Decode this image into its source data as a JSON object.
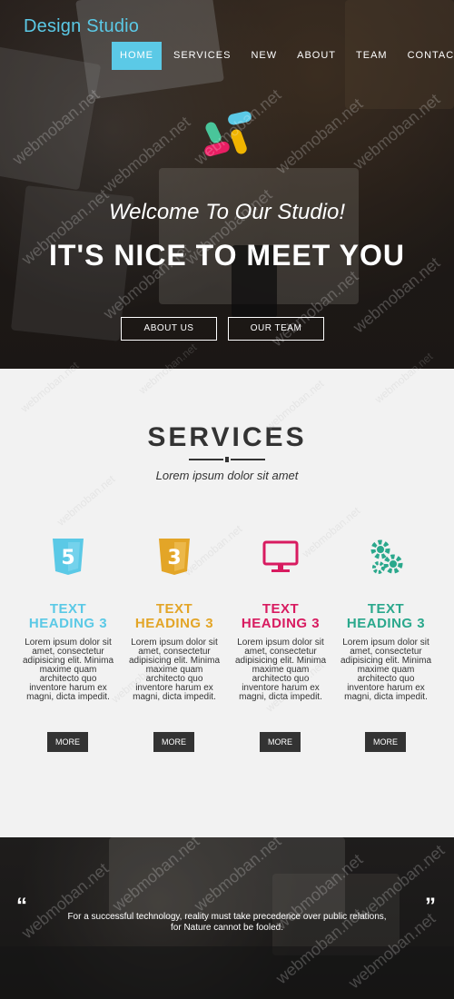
{
  "brand": {
    "name": "Design Studio"
  },
  "nav": {
    "items": [
      "HOME",
      "SERVICES",
      "NEW",
      "ABOUT",
      "TEAM",
      "CONTACT"
    ],
    "active_index": 0
  },
  "hero": {
    "welcome": "Welcome To Our Studio!",
    "headline": "IT'S NICE TO MEET YOU",
    "buttons": [
      {
        "label": "ABOUT US"
      },
      {
        "label": "OUR TEAM"
      }
    ]
  },
  "services": {
    "title": "SERVICES",
    "subtitle": "Lorem ipsum dolor sit amet",
    "items": [
      {
        "icon": "html5-icon",
        "heading_line1": "TEXT",
        "heading_line2": "HEADING 3",
        "color": "#5bc9e6",
        "text": "Lorem ipsum dolor sit amet, consectetur adipisicing elit. Minima maxime quam architecto quo inventore harum ex magni, dicta impedit.",
        "button": "MORE"
      },
      {
        "icon": "css3-icon",
        "heading_line1": "TEXT",
        "heading_line2": "HEADING 3",
        "color": "#e3a527",
        "text": "Lorem ipsum dolor sit amet, consectetur adipisicing elit. Minima maxime quam architecto quo inventore harum ex magni, dicta impedit.",
        "button": "MORE"
      },
      {
        "icon": "monitor-icon",
        "heading_line1": "TEXT",
        "heading_line2": "HEADING 3",
        "color": "#d81b60",
        "text": "Lorem ipsum dolor sit amet, consectetur adipisicing elit. Minima maxime quam architecto quo inventore harum ex magni, dicta impedit.",
        "button": "MORE"
      },
      {
        "icon": "gears-icon",
        "heading_line1": "TEXT",
        "heading_line2": "HEADING 3",
        "color": "#2aa88c",
        "text": "Lorem ipsum dolor sit amet, consectetur adipisicing elit. Minima maxime quam architecto quo inventore harum ex magni, dicta impedit.",
        "button": "MORE"
      }
    ]
  },
  "quote": {
    "text": "For a successful technology, reality must take precedence over public relations, for Nature cannot be fooled.",
    "open": "“",
    "close": "”"
  },
  "watermark": "webmoban.net",
  "colors": {
    "accent": "#5bc9e6",
    "dark": "#333333",
    "bg": "#f2f2f2"
  }
}
